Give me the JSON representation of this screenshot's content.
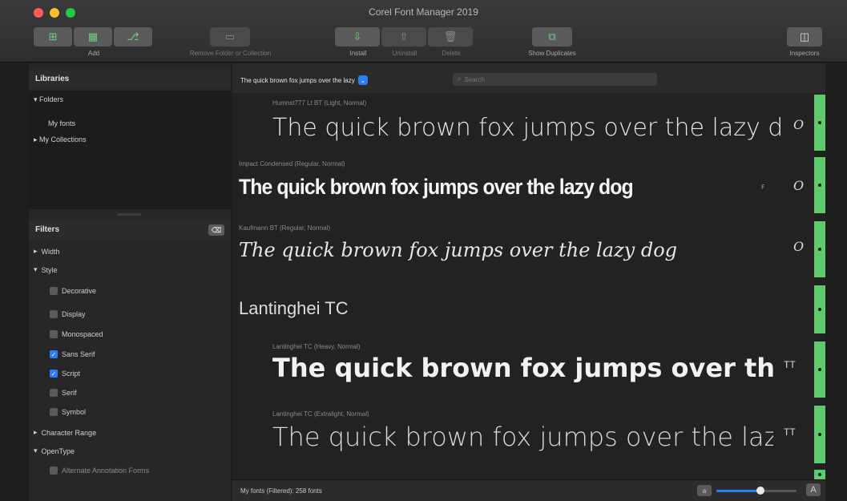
{
  "window": {
    "title": "Corel Font Manager 2019"
  },
  "toolbar": {
    "add_label": "Add",
    "remove_label": "Remove Folder or Collection",
    "install_label": "Install",
    "uninstall_label": "Uninstall",
    "delete_label": "Delete",
    "duplicates_label": "Show Duplicates",
    "inspectors_label": "Inspectors"
  },
  "sidebar": {
    "libraries_title": "Libraries",
    "folders_label": "Folders",
    "my_fonts_label": "My fonts",
    "collections_label": "My Collections",
    "filters_title": "Filters",
    "filter_action": "⌫",
    "filters": {
      "width": "Width",
      "style": "Style",
      "decorative": "Decorative",
      "display": "Display",
      "monospaced": "Monospaced",
      "sans_serif": "Sans Serif",
      "script": "Script",
      "serif": "Serif",
      "symbol": "Symbol",
      "character_range": "Character Range",
      "opentype": "OpenType",
      "alternate": "Alternate Annotation Forms"
    }
  },
  "main": {
    "sample_text": "The quick brown fox jumps over the lazy",
    "search_placeholder": "Search",
    "status": "My fonts (Filtered): 258 fonts"
  },
  "fonts": [
    {
      "meta": "Humnst777 Lt BT (Light, Normal)",
      "sample": "The quick brown fox jumps over the lazy dog"
    },
    {
      "meta": "Impact Condensed (Regular, Normal)",
      "sample": "The quick brown fox jumps over the lazy dog"
    },
    {
      "meta": "Kaufmann BT (Regular, Normal)",
      "sample": "The quick brown fox jumps over the lazy dog"
    },
    {
      "family_heading": "Lantinghei TC"
    },
    {
      "meta": "Lantinghei TC (Heavy, Normal)",
      "sample": "The quick brown fox jumps over the lazy dog"
    },
    {
      "meta": "Lantinghei TC (Extralight, Normal)",
      "sample": "The quick brown fox jumps over the lazy dog"
    }
  ],
  "zoom_level": 0.55,
  "colors": {
    "active": "#5fc96e",
    "accent": "#2d7cf6"
  }
}
